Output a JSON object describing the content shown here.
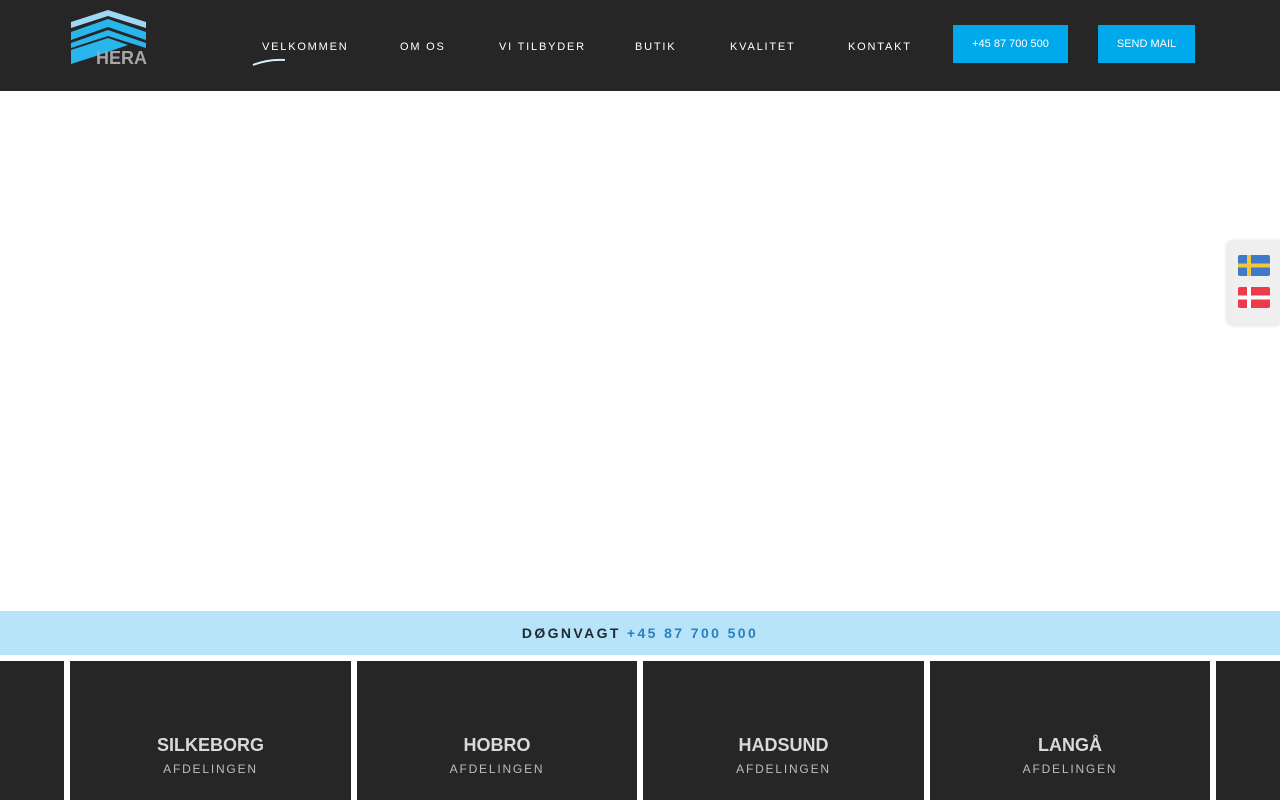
{
  "header": {
    "logo_text": "HERA",
    "nav": [
      {
        "label": "VELKOMMEN",
        "active": true
      },
      {
        "label": "OM OS"
      },
      {
        "label": "VI TILBYDER"
      },
      {
        "label": "BUTIK"
      },
      {
        "label": "KVALITET"
      },
      {
        "label": "KONTAKT"
      }
    ],
    "phone_button": "+45 87 700 500",
    "mail_button": "SEND MAIL"
  },
  "languages": [
    "sv",
    "da"
  ],
  "emergency": {
    "label": "DØGNVAGT",
    "number": "+45 87 700 500"
  },
  "departments": [
    {
      "name": "SILKEBORG",
      "sub": "AFDELINGEN"
    },
    {
      "name": "HOBRO",
      "sub": "AFDELINGEN"
    },
    {
      "name": "HADSUND",
      "sub": "AFDELINGEN"
    },
    {
      "name": "LANGÅ",
      "sub": "AFDELINGEN"
    }
  ],
  "colors": {
    "header_bg": "#262626",
    "accent": "#00a9ec",
    "emergency_bg": "#b8e4f9",
    "emergency_number": "#2a7fc1"
  }
}
